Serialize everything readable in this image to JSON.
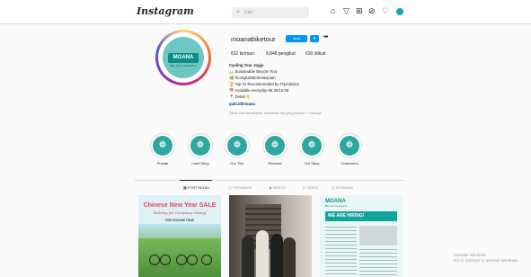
{
  "topbar": {
    "logo": "Instagram",
    "search_placeholder": "Cari",
    "icons": [
      "home-icon",
      "explore-icon",
      "direct-icon",
      "compass-icon",
      "heart-icon"
    ]
  },
  "profile": {
    "username": "moanabiketour",
    "follow_label": "Ikuti",
    "dropdown_label": "▾",
    "more_label": "•••",
    "posts": "812 kiriman",
    "followers": "8,848 pengikut",
    "following": "630 diikuti",
    "brand_name": "MOANA",
    "brand_sub": "Bike Tour & Adventure",
    "bio": [
      "Cycling Tour Jogja",
      "🚲 Sustainable Bicycle Tour",
      "🌿 #LangkahBerkelanjutan",
      "🏆 Top #1 Recommended by TripAdvisor",
      "📅 Available everyday 06.30/15.00",
      "📍 Detail 👇"
    ],
    "link": "yubi.id/moana",
    "followed_by": "Diikuti oleh karsembike, moanainfo dan yang lainnya + 3 lainnya"
  },
  "highlights": [
    {
      "label": "Private"
    },
    {
      "label": "Lane Story"
    },
    {
      "label": "Our Tour"
    },
    {
      "label": "Reviews"
    },
    {
      "label": "Our Story"
    },
    {
      "label": "Customers"
    }
  ],
  "tabs": [
    {
      "label": "POSTINGAN",
      "active": true
    },
    {
      "label": "FEEDBACK",
      "active": false
    },
    {
      "label": "REELS",
      "active": false
    },
    {
      "label": "VIDEO",
      "active": false
    },
    {
      "label": "DITANDAI",
      "active": false
    }
  ],
  "posts": [
    {
      "title": "Chinese New Year SALE",
      "subtitle": "Holiday for Company Outing",
      "detail": "FOR CYCLING TOUR"
    },
    {},
    {
      "brand": "MOANA",
      "brand_sub": "Bike Tour & Adventure",
      "headline": "WE ARE HIRING!"
    }
  ],
  "watermark": [
    "Activate Windows",
    "Go to Settings to activate Windows."
  ],
  "colors": {
    "accent": "#0095f6",
    "brand": "#0a8f86"
  }
}
